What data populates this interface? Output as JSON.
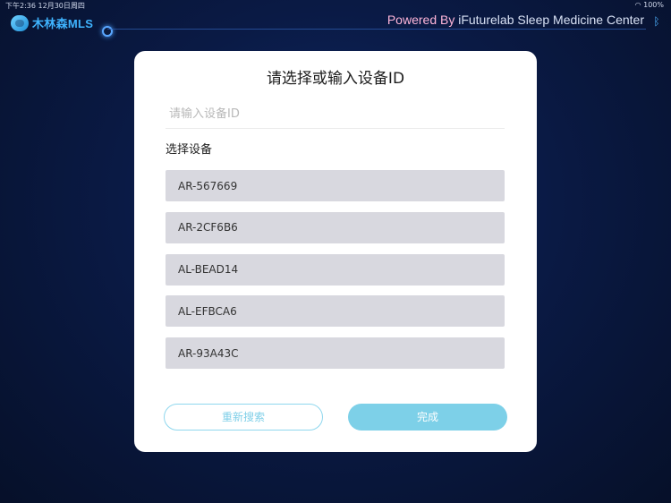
{
  "status_bar": {
    "time": "下午2:36",
    "date": "12月30日周四",
    "battery": "100%"
  },
  "header": {
    "logo_text": "木林森MLS",
    "powered_prefix": "Powered By ",
    "powered_name": "iFuturelab Sleep Medicine Center"
  },
  "dialog": {
    "title": "请选择或输入设备ID",
    "input_placeholder": "请输入设备ID",
    "input_value": "",
    "section_label": "选择设备",
    "devices": [
      "AR-567669",
      "AR-2CF6B6",
      "AL-BEAD14",
      "AL-EFBCA6",
      "AR-93A43C"
    ],
    "rescan_label": "重新搜索",
    "done_label": "完成"
  },
  "colors": {
    "background": "#0a1a45",
    "accent": "#7dd0e8",
    "device_item_bg": "#d8d8df"
  }
}
